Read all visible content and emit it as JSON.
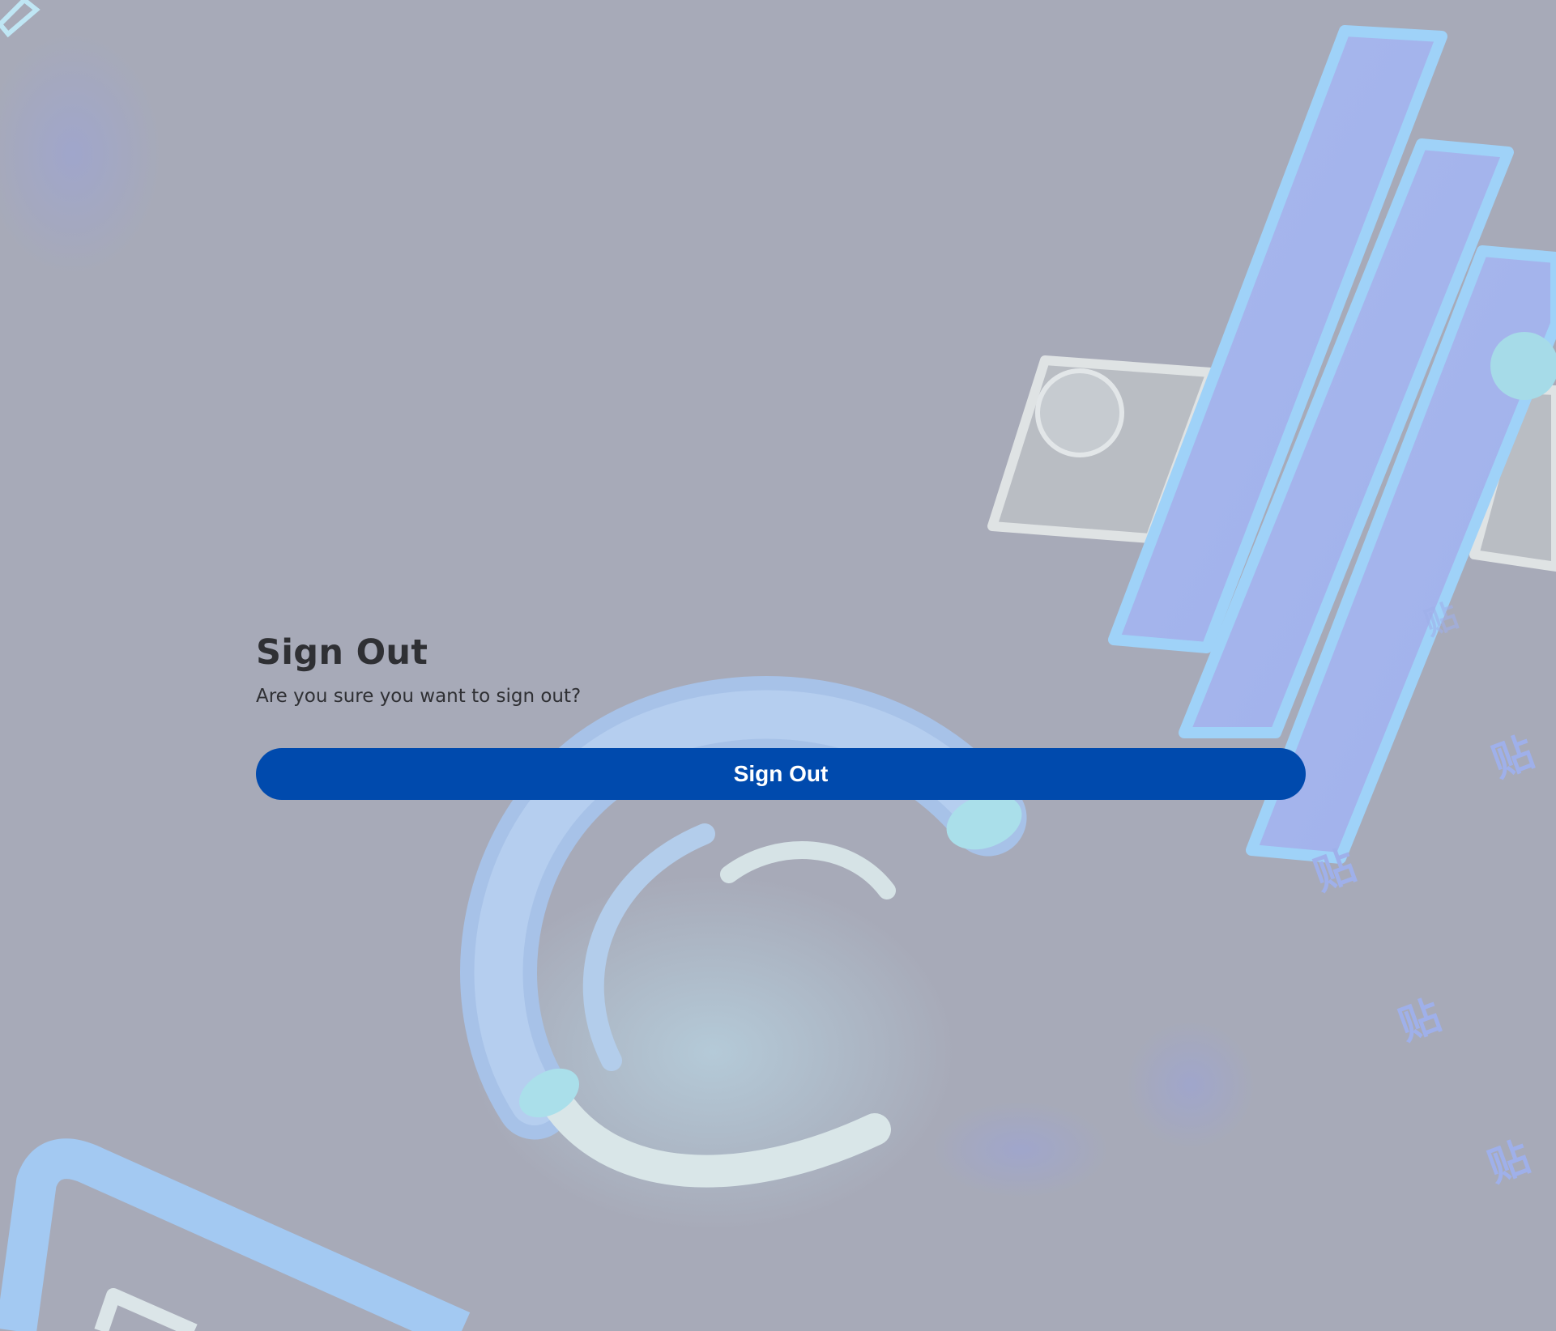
{
  "dialog": {
    "title": "Sign Out",
    "message": "Are you sure you want to sign out?",
    "confirm_label": "Sign Out"
  },
  "colors": {
    "background": "#a7aab8",
    "button": "#004aad",
    "button_text": "#ffffff",
    "text": "#2f3034"
  },
  "background_art": {
    "icon": "abstract-3d-shapes",
    "glyph": "贴"
  }
}
